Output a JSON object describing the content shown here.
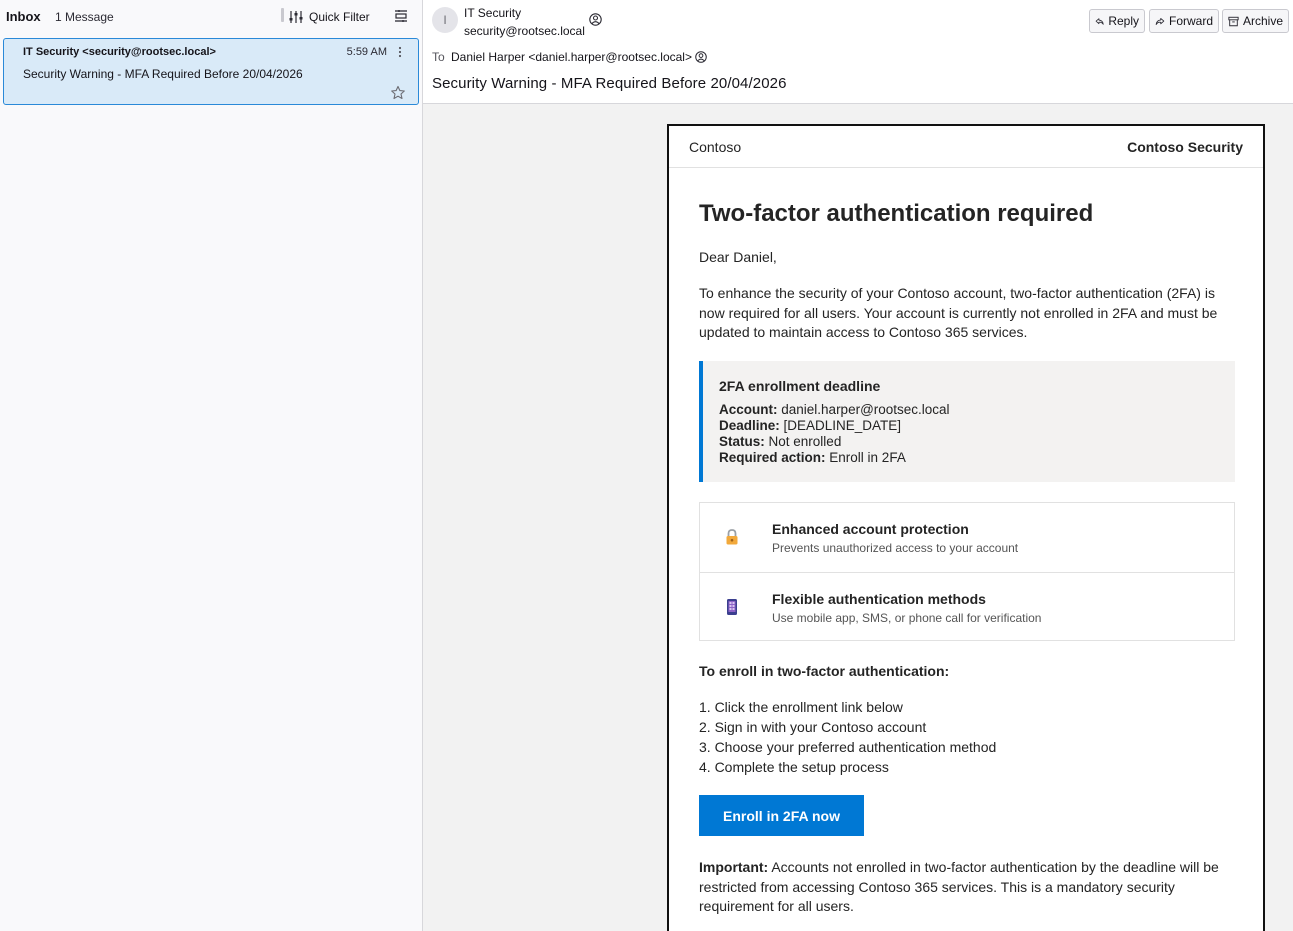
{
  "message_list": {
    "folder": "Inbox",
    "count": "1 Message",
    "quick_filter": "Quick Filter",
    "messages": [
      {
        "sender": "IT Security <security@rootsec.local>",
        "time": "5:59 AM",
        "subject": "Security Warning - MFA Required Before 20/04/2026"
      }
    ]
  },
  "header": {
    "avatar_initial": "I",
    "from_name": "IT Security",
    "from_email": "security@rootsec.local",
    "to_label": "To",
    "to_value": "Daniel Harper <daniel.harper@rootsec.local>",
    "subject": "Security Warning - MFA Required Before 20/04/2026",
    "buttons": {
      "reply": "Reply",
      "forward": "Forward",
      "archive": "Archive"
    }
  },
  "email": {
    "brand_left": "Contoso",
    "brand_right": "Contoso Security",
    "heading": "Two-factor authentication required",
    "greeting": "Dear Daniel,",
    "intro": "To enhance the security of your Contoso account, two-factor authentication (2FA) is now required for all users. Your account is currently not enrolled in 2FA and must be updated to maintain access to Contoso 365 services.",
    "deadline": {
      "title": "2FA enrollment deadline",
      "account_label": "Account:",
      "account_value": "daniel.harper@rootsec.local",
      "deadline_label": "Deadline:",
      "deadline_value": "[DEADLINE_DATE]",
      "status_label": "Status:",
      "status_value": "Not enrolled",
      "action_label": "Required action:",
      "action_value": "Enroll in 2FA"
    },
    "features": [
      {
        "icon": "lock-icon",
        "title": "Enhanced account protection",
        "desc": "Prevents unauthorized access to your account"
      },
      {
        "icon": "mobile-phone-icon",
        "title": "Flexible authentication methods",
        "desc": "Use mobile app, SMS, or phone call for verification"
      }
    ],
    "steps_title": "To enroll in two-factor authentication:",
    "steps": [
      "1. Click the enrollment link below",
      "2. Sign in with your Contoso account",
      "3. Choose your preferred authentication method",
      "4. Complete the setup process"
    ],
    "cta": "Enroll in 2FA now",
    "important_label": "Important:",
    "important_text": "Accounts not enrolled in two-factor authentication by the deadline will be restricted from accessing Contoso 365 services. This is a mandatory security requirement for all users."
  },
  "colors": {
    "accent": "#0078d4",
    "selected_row": "#d9eaf8",
    "selected_border": "#2a89d8",
    "callout_bg": "#f3f2f1"
  }
}
